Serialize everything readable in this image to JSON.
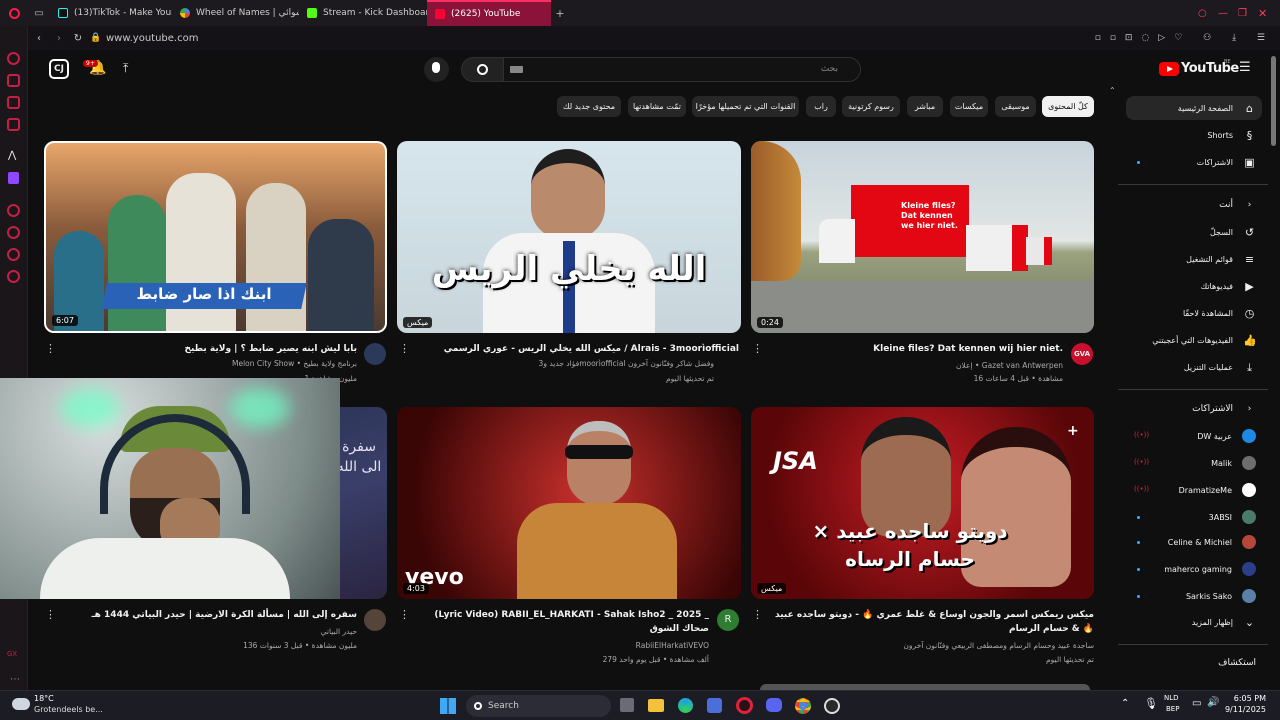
{
  "browser": {
    "tabs": [
      {
        "label": "(13)TikTok - Make Your Day",
        "color": "#111111"
      },
      {
        "label": "Wheel of Names | عشوائي",
        "color": "#4285f4"
      },
      {
        "label": "Stream - Kick Dashboard",
        "color": "#53fc18"
      },
      {
        "label": "(2625) YouTube",
        "color": "#ff0033",
        "active": true
      }
    ],
    "url": "www.youtube.com"
  },
  "header": {
    "logo_text": "YouTube",
    "logo_region": "BE",
    "search_placeholder": "بحث",
    "notif_count": "9+"
  },
  "chips": [
    {
      "label": "كلّ المحتوى",
      "selected": true
    },
    {
      "label": "موسيقى"
    },
    {
      "label": "ميكسات"
    },
    {
      "label": "مباشر"
    },
    {
      "label": "رسوم كرتونية"
    },
    {
      "label": "راب"
    },
    {
      "label": "القنوات التي تم تحميلها مؤخرًا"
    },
    {
      "label": "تمّت مشاهدتها"
    },
    {
      "label": "محتوى جديد لك"
    }
  ],
  "sidebar": {
    "main": [
      {
        "label": "الصفحة الرئيسية",
        "icon": "home-icon",
        "selected": true
      },
      {
        "label": "Shorts",
        "icon": "shorts-icon"
      },
      {
        "label": "الاشتراكات",
        "icon": "subscriptions-icon"
      }
    ],
    "you_heading": "أنت",
    "you": [
      {
        "label": "السجلّ",
        "icon": "history-icon"
      },
      {
        "label": "قوائم التشغيل",
        "icon": "playlists-icon"
      },
      {
        "label": "فيديوهاتك",
        "icon": "your-videos-icon"
      },
      {
        "label": "المشاهدة لاحقًا",
        "icon": "watch-later-icon"
      },
      {
        "label": "الفيديوهات التي أعجبتني",
        "icon": "liked-icon"
      },
      {
        "label": "عمليات التنزيل",
        "icon": "download-icon"
      }
    ],
    "subs_heading": "الاشتراكات",
    "subs": [
      {
        "label": "DW عربية",
        "color": "#1e88e5"
      },
      {
        "label": "Malik",
        "color": "#6d6d6d"
      },
      {
        "label": "DramatizeMe",
        "color": "#ffffff"
      },
      {
        "label": "3ABSI",
        "color": "#4a7a6a"
      },
      {
        "label": "Celine & Michiel",
        "color": "#b5473a"
      },
      {
        "label": "maherco gaming",
        "color": "#2c3e8a"
      },
      {
        "label": "Sarkis Sako",
        "color": "#5a7fa8"
      }
    ],
    "show_more": "إظهار المزيد",
    "explore_heading": "استكشاف"
  },
  "videos": [
    {
      "title": "Kleine files? Dat kennen wij hier niet.",
      "line2": "إعلان • Gazet van Antwerpen",
      "line3": "16 مشاهدة • قبل 4 ساعات",
      "duration": "0:24",
      "thumb_text": "Kleine files? Dat kennen we hier niet.",
      "avatar_text": "GVA",
      "avatar_color": "#c8102e"
    },
    {
      "title": "ميكس الله يخلي الريس - عوري الرسمي / Alrais - 3moorìofficial",
      "line2": "فؤاد جديد و3moorìofficial وفضل شاكر وفنّانون آخرون",
      "line3": "تم تحديثها اليوم",
      "duration": "ميكس",
      "thumb_text": "الله يخلي الريس",
      "avatar_text": "",
      "avatar_color": ""
    },
    {
      "title": "بابا ليش ابنه يصير ضابط ؟ | ولاية بطيخ",
      "line2": "Melon City Show • برنامج ولاية بطيخ",
      "line3": "1 مليون مشاهدة",
      "duration": "6:07",
      "thumb_text": "ابنك اذا صار ضابط",
      "avatar_text": "",
      "avatar_color": "#2b3a5a"
    },
    {
      "title": "ميكس ريمكس اسمر والجون اوساع & غلط عمري 🔥 - دويتو ساجده عبيد & حسام الرسام 🔥",
      "line2": "ساجدة عبيد وحسام الرسام ومصطفى الربيعي وفنّانون آخرون",
      "line3": "تم تحديثها اليوم",
      "duration": "ميكس",
      "thumb_text": "دويتو ساجده عبيد × حسام الرساه",
      "avatar_text": "",
      "avatar_color": ""
    },
    {
      "title": "(Lyric Video) RABII_EL_HARKATI - Sahak Isho2 _ 2025 _ صحاك الشوق",
      "line2": "RabiiElHarkatiVEVO",
      "line3": "279 ألف مشاهدة • قبل يوم واحد",
      "duration": "4:03",
      "thumb_text": "vevo",
      "avatar_text": "R",
      "avatar_color": "#2e7d32"
    },
    {
      "title": "سفره إلى الله | مسألة الكرة الارضية | حيدر البياتي 1444 هـ",
      "line2": "حيدر البياتي",
      "line3": "136 مليون مشاهدة • قبل 3 سنوات",
      "duration": "",
      "thumb_text": "سفرة الى الله",
      "avatar_text": "",
      "avatar_color": "#55443a"
    }
  ],
  "taskbar": {
    "weather_temp": "18°C",
    "weather_desc": "Grotendeels be...",
    "search_label": "Search",
    "lang": "NLD",
    "lang2": "BEP",
    "time": "6:05 PM",
    "date": "9/11/2025"
  }
}
